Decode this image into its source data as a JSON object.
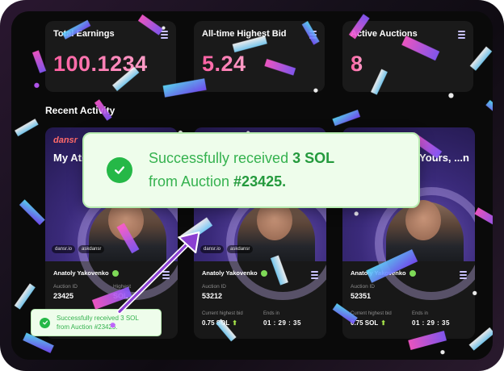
{
  "stats": [
    {
      "label": "Total Earnings",
      "value": "100.1234"
    },
    {
      "label": "All-time Highest Bid",
      "value": "5.24"
    },
    {
      "label": "Active Auctions",
      "value": "8"
    }
  ],
  "recent_activity": {
    "title": "Recent Activity"
  },
  "cards": [
    {
      "brand": "dansr",
      "headline": "My At... Bids A...",
      "chips": [
        "dansr.io",
        "askdansr"
      ],
      "owner": "Anatoly Yakovenko",
      "auction_id_label": "Auction ID",
      "auction_id": "23425",
      "bid_label": "Highest",
      "bid_value": "SOL",
      "ends_label": "",
      "ends_value": ""
    },
    {
      "brand": "",
      "headline": "",
      "chips": [
        "dansr.io",
        "askdansr"
      ],
      "owner": "Anatoly Yakovenko",
      "auction_id_label": "Auction ID",
      "auction_id": "53212",
      "bid_label": "Current highest bid",
      "bid_value": "0.75 SOL",
      "ends_label": "Ends in",
      "ends_value": "01 : 29 : 35"
    },
    {
      "brand": "",
      "headline": "...is Yours, ...n",
      "chips": [],
      "owner": "Anatoly Yakovenko",
      "auction_id_label": "Auction ID",
      "auction_id": "52351",
      "bid_label": "Current highest bid",
      "bid_value": "0.75 SOL",
      "ends_label": "Ends in",
      "ends_value": "01 : 29 : 35"
    }
  ],
  "toast_big": {
    "prefix": "Successfully received ",
    "amount": "3 SOL",
    "middle": "from Auction ",
    "auction": "#23425."
  },
  "toast_small": {
    "line1": "Successfully received 3 SOL",
    "line2": "from Auction #23425."
  },
  "colors": {
    "accent_pink": "#ff5fa2",
    "success_green": "#25b847",
    "toast_bg": "#eefdeb",
    "arrow_purple": "#8a3fd1"
  },
  "icons": [
    "menu-icon",
    "check-icon",
    "verified-icon",
    "arrow-up-icon",
    "x-icon"
  ]
}
